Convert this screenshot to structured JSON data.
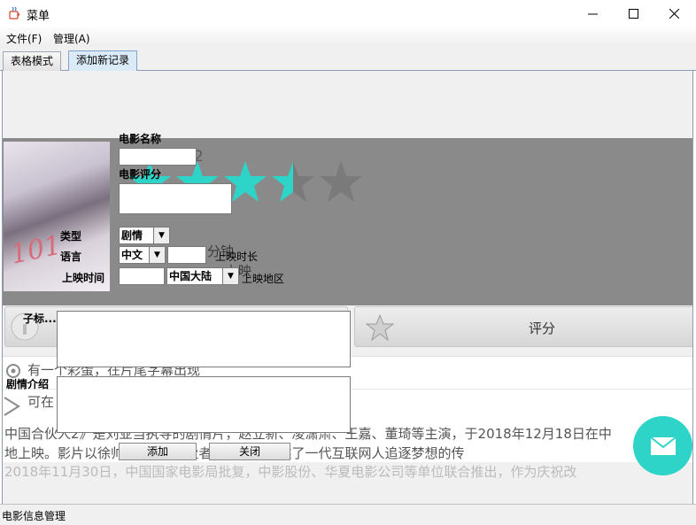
{
  "window": {
    "title": "菜单",
    "app_icon": "java-cup-icon",
    "controls": {
      "minimize": "—",
      "maximize": "☐",
      "close": "✕"
    }
  },
  "menubar": {
    "items": [
      {
        "label": "文件(F)"
      },
      {
        "label": "管理(A)"
      }
    ]
  },
  "tabs": [
    {
      "label": "表格模式",
      "selected": false
    },
    {
      "label": "添加新记录",
      "selected": true
    }
  ],
  "form": {
    "movie_name_label": "电影名称",
    "movie_name_value": "",
    "rating_label": "电影评分",
    "rating_value": "",
    "type_label": "类型",
    "type_value": "剧情",
    "language_label": "语言",
    "language_value": "中文",
    "duration_label": "上映时长",
    "duration_value": "",
    "release_time_label": "上映时间",
    "release_time_value": "",
    "region_label": "上映地区",
    "region_value": "中国大陆",
    "subtitle_label": "子标...",
    "subtitle_value": "",
    "plot_label": "剧情介绍",
    "plot_value": "",
    "add_button": "添加",
    "close_button": "关闭"
  },
  "background": {
    "ghost_title": "中国合伙人2",
    "ghost_duration": "分钟",
    "ghost_release": "上映",
    "rate_button": "评分",
    "ghost_line1": "有一个彩蛋，在片尾字幕出现",
    "ghost_line2": "可在",
    "ghost_para1": "中国合伙人2》是刘亚当执导的剧情片，赵立新、凌潇肃、王嘉、董琦等主演，于2018年12月18日在中",
    "ghost_para2": "地上映。影片以徐帅            班            员向创业者的蜕变，讲述了一代互联网人追逐梦想的传",
    "ghost_para3": "2018年11月30日，中国国家电影局批复，中影股份、华夏电影公司等单位联合推出，作为庆祝改",
    "poster_text": "101",
    "rating_stars": 3.5,
    "star_color": "#2fd4c8",
    "fab_icon": "mail-icon"
  },
  "status": {
    "text": "电影信息管理"
  }
}
